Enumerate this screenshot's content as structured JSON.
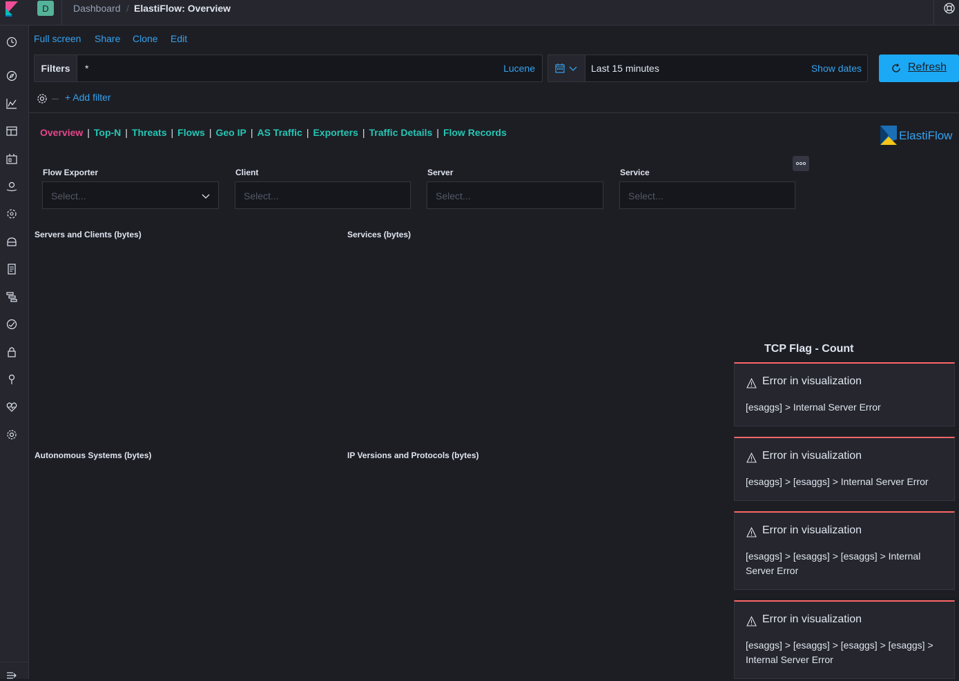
{
  "header": {
    "avatar_letter": "D",
    "breadcrumb_parent": "Dashboard",
    "breadcrumb_separator": "/",
    "breadcrumb_current": "ElastiFlow: Overview"
  },
  "menu": {
    "full_screen": "Full screen",
    "share": "Share",
    "clone": "Clone",
    "edit": "Edit"
  },
  "query": {
    "filters_label": "Filters",
    "value": "*",
    "language": "Lucene",
    "time_range": "Last 15 minutes",
    "show_dates": "Show dates",
    "refresh": "Refresh",
    "add_filter": "+ Add filter"
  },
  "tabs": [
    {
      "label": "Overview",
      "active": true
    },
    {
      "label": "Top-N",
      "active": false
    },
    {
      "label": "Threats",
      "active": false
    },
    {
      "label": "Flows",
      "active": false
    },
    {
      "label": "Geo IP",
      "active": false
    },
    {
      "label": "AS Traffic",
      "active": false
    },
    {
      "label": "Exporters",
      "active": false
    },
    {
      "label": "Traffic Details",
      "active": false
    },
    {
      "label": "Flow Records",
      "active": false
    }
  ],
  "tab_separator": "|",
  "logo_text": "ElastiFlow",
  "controls": [
    {
      "label": "Flow Exporter",
      "placeholder": "Select..."
    },
    {
      "label": "Client",
      "placeholder": "Select..."
    },
    {
      "label": "Server",
      "placeholder": "Select..."
    },
    {
      "label": "Service",
      "placeholder": "Select..."
    }
  ],
  "panels": {
    "servers_clients": "Servers and Clients (bytes)",
    "services": "Services (bytes)",
    "autonomous_systems": "Autonomous Systems (bytes)",
    "ip_versions": "IP Versions and Protocols (bytes)",
    "tcp_flag": "TCP Flag - Count"
  },
  "errors": [
    {
      "title": "Error in visualization",
      "message": "[esaggs] > Internal Server Error"
    },
    {
      "title": "Error in visualization",
      "message": "[esaggs] > [esaggs] > Internal Server Error"
    },
    {
      "title": "Error in visualization",
      "message": "[esaggs] > [esaggs] > [esaggs] > Internal Server Error"
    },
    {
      "title": "Error in visualization",
      "message": "[esaggs] > [esaggs] > [esaggs] > [esaggs] > Internal Server Error"
    }
  ],
  "colors": {
    "accent": "#36a2ef",
    "tab": "#26c6b4",
    "tab_active": "#e7478a",
    "error": "#ff6666"
  }
}
